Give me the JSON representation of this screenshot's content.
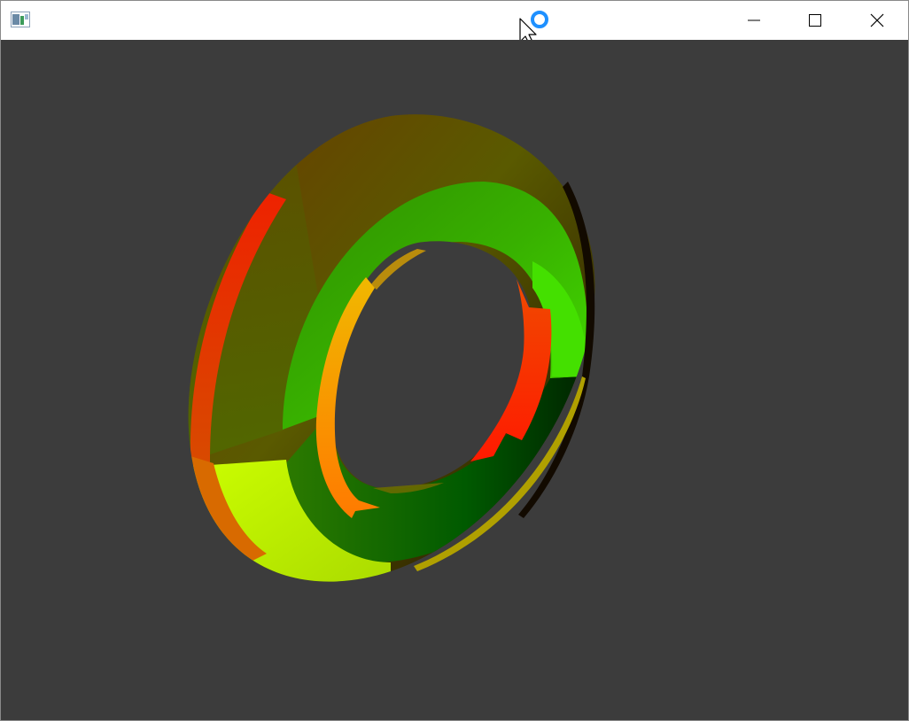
{
  "window": {
    "title": "",
    "background_color": "#3c3c3c",
    "controls": {
      "minimize_icon": "minimize-icon",
      "maximize_icon": "maximize-icon",
      "close_icon": "close-icon"
    }
  },
  "titlebar": {
    "app_icon": "app-window-icon",
    "busy_cursor_icon": "busy-cursor-icon",
    "accent_color": "#1e90ff"
  },
  "scene": {
    "object": "torus",
    "colors": {
      "outer_top": "#6b3a00",
      "outer_left": "#5a6a00",
      "inner_ring": "#38b000",
      "inner_right": "#44e000",
      "lower_right": "#005a00",
      "lower_left": "#ccff00",
      "edge_red": "#ee2200",
      "inner_orange": "#ff8800",
      "inner_red": "#ff2200",
      "dark_edge": "#1a0a00"
    }
  }
}
